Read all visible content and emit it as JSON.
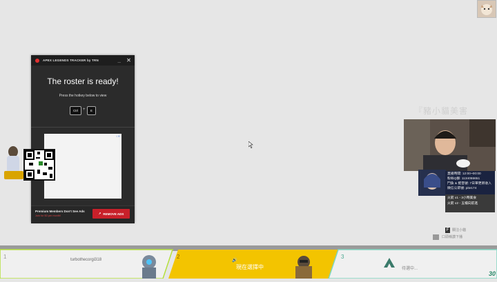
{
  "tracker": {
    "title": "APEX LEGENDS TRACKER by TRN",
    "minimize": "_",
    "close": "✕",
    "ready": "The roster is ready!",
    "hint": "Press the hotkey below to view",
    "key1": "Ctrl",
    "plus": "+",
    "key2": "E",
    "ad_flag": "i ✕",
    "premium": "Premium Members Don't See Ads",
    "price": "Join for $3 per month!",
    "remove": "REMOVE ADS"
  },
  "stream_info": {
    "watermark": "『豬小貓美害",
    "lines": [
      "直播時間: 12:00~00:00",
      "粉絲Q群: 1134055651",
      "鬥魚 & 抳音號: 7日單更新收入",
      "微信公眾號: pite174"
    ],
    "banner": [
      "火箭 x1 - 3小時美食",
      "火箭 x2 - 五檔向前進"
    ],
    "follower_line1": "關注小貓",
    "follower_line2": "口頭稱讚下播"
  },
  "queue": {
    "slot1_num": "1",
    "slot1_name": "turbothecorgi318",
    "slot2_num": "2",
    "slot2_status": "現在選擇中",
    "slot3_num": "3",
    "slot3_status": "待選中...",
    "timer": "30"
  },
  "colors": {
    "accent_yellow": "#f3c400",
    "accent_green": "#b4e03c",
    "accent_teal": "#7fd6c0",
    "remove_red": "#c8202a"
  }
}
